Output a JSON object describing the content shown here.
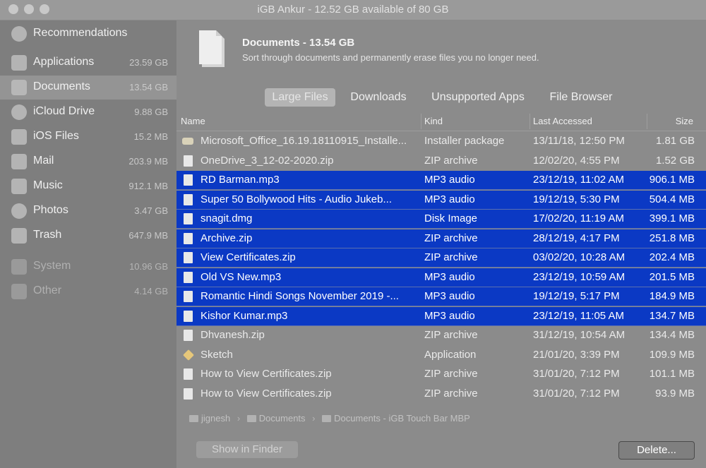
{
  "window": {
    "title": "iGB Ankur - 12.52 GB available of 80 GB"
  },
  "sidebar": {
    "items": [
      {
        "label": "Recommendations",
        "size": "",
        "icon": "recommendations-icon"
      },
      {
        "label": "Applications",
        "size": "23.59 GB",
        "icon": "applications-icon"
      },
      {
        "label": "Documents",
        "size": "13.54 GB",
        "icon": "documents-icon",
        "selected": true
      },
      {
        "label": "iCloud Drive",
        "size": "9.88 GB",
        "icon": "icloud-icon"
      },
      {
        "label": "iOS Files",
        "size": "15.2 MB",
        "icon": "ios-icon"
      },
      {
        "label": "Mail",
        "size": "203.9 MB",
        "icon": "mail-icon"
      },
      {
        "label": "Music",
        "size": "912.1 MB",
        "icon": "music-icon"
      },
      {
        "label": "Photos",
        "size": "3.47 GB",
        "icon": "photos-icon"
      },
      {
        "label": "Trash",
        "size": "647.9 MB",
        "icon": "trash-icon"
      },
      {
        "label": "System",
        "size": "10.96 GB",
        "icon": "system-icon"
      },
      {
        "label": "Other",
        "size": "4.14 GB",
        "icon": "other-icon"
      }
    ]
  },
  "header": {
    "title": "Documents - 13.54 GB",
    "subtitle": "Sort through documents and permanently erase files you no longer need."
  },
  "tabs": [
    {
      "label": "Large Files",
      "active": true
    },
    {
      "label": "Downloads"
    },
    {
      "label": "Unsupported Apps"
    },
    {
      "label": "File Browser"
    }
  ],
  "table": {
    "columns": {
      "name": "Name",
      "kind": "Kind",
      "accessed": "Last Accessed",
      "size": "Size"
    },
    "rows": [
      {
        "name": "Microsoft_Office_16.19.18110915_Installe...",
        "kind": "Installer package",
        "accessed": "13/11/18, 12:50 PM",
        "size": "1.81 GB",
        "selected": false,
        "icon": "installer-icon"
      },
      {
        "name": "OneDrive_3_12-02-2020.zip",
        "kind": "ZIP archive",
        "accessed": "12/02/20, 4:55 PM",
        "size": "1.52 GB",
        "selected": false,
        "icon": "file-icon"
      },
      {
        "name": "RD Barman.mp3",
        "kind": "MP3 audio",
        "accessed": "23/12/19, 11:02 AM",
        "size": "906.1 MB",
        "selected": true,
        "icon": "file-icon"
      },
      {
        "name": "Super 50 Bollywood Hits - Audio Jukeb...",
        "kind": "MP3 audio",
        "accessed": "19/12/19, 5:30 PM",
        "size": "504.4 MB",
        "selected": true,
        "icon": "file-icon"
      },
      {
        "name": "snagit.dmg",
        "kind": "Disk Image",
        "accessed": "17/02/20, 11:19 AM",
        "size": "399.1 MB",
        "selected": true,
        "icon": "file-icon"
      },
      {
        "name": "Archive.zip",
        "kind": "ZIP archive",
        "accessed": "28/12/19, 4:17 PM",
        "size": "251.8 MB",
        "selected": true,
        "icon": "file-icon"
      },
      {
        "name": "View Certificates.zip",
        "kind": "ZIP archive",
        "accessed": "03/02/20, 10:28 AM",
        "size": "202.4 MB",
        "selected": true,
        "icon": "file-icon"
      },
      {
        "name": "Old VS New.mp3",
        "kind": "MP3 audio",
        "accessed": "23/12/19, 10:59 AM",
        "size": "201.5 MB",
        "selected": true,
        "icon": "file-icon"
      },
      {
        "name": "Romantic Hindi Songs November 2019 -...",
        "kind": "MP3 audio",
        "accessed": "19/12/19, 5:17 PM",
        "size": "184.9 MB",
        "selected": true,
        "icon": "file-icon"
      },
      {
        "name": "Kishor Kumar.mp3",
        "kind": "MP3 audio",
        "accessed": "23/12/19, 11:05 AM",
        "size": "134.7 MB",
        "selected": true,
        "icon": "file-icon"
      },
      {
        "name": "Dhvanesh.zip",
        "kind": "ZIP archive",
        "accessed": "31/12/19, 10:54 AM",
        "size": "134.4 MB",
        "selected": false,
        "icon": "file-icon"
      },
      {
        "name": "Sketch",
        "kind": "Application",
        "accessed": "21/01/20, 3:39 PM",
        "size": "109.9 MB",
        "selected": false,
        "icon": "sketch-icon"
      },
      {
        "name": "How to View Certificates.zip",
        "kind": "ZIP archive",
        "accessed": "31/01/20, 7:12 PM",
        "size": "101.1 MB",
        "selected": false,
        "icon": "file-icon"
      },
      {
        "name": "How to View Certificates.zip",
        "kind": "ZIP archive",
        "accessed": "31/01/20, 7:12 PM",
        "size": "93.9 MB",
        "selected": false,
        "icon": "file-icon"
      }
    ]
  },
  "path_bar": {
    "segments": [
      "jignesh",
      "Documents",
      "Documents - iGB Touch Bar MBP"
    ]
  },
  "buttons": {
    "show_in_finder": "Show in Finder",
    "delete": "Delete..."
  },
  "colors": {
    "selection": "#0b39c4",
    "background": "#8b8b8b"
  }
}
